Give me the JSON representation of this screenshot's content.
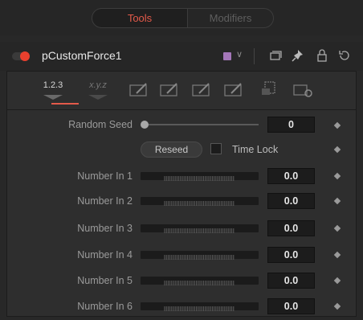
{
  "tabs": {
    "tools": "Tools",
    "modifiers": "Modifiers"
  },
  "tool": {
    "name": "pCustomForce1",
    "color": "#a477b9"
  },
  "panel_tabs": {
    "numbers": "1.2.3",
    "points": "x.y.z"
  },
  "random_seed": {
    "label": "Random Seed",
    "value": "0",
    "slider_fraction": 0
  },
  "reseed_button": "Reseed",
  "time_lock": {
    "label": "Time Lock",
    "checked": false
  },
  "numbers": [
    {
      "label": "Number In 1",
      "value": "0.0"
    },
    {
      "label": "Number In 2",
      "value": "0.0"
    },
    {
      "label": "Number In 3",
      "value": "0.0"
    },
    {
      "label": "Number In 4",
      "value": "0.0"
    },
    {
      "label": "Number In 5",
      "value": "0.0"
    },
    {
      "label": "Number In 6",
      "value": "0.0"
    }
  ],
  "accent_color": "#e35a4a",
  "icons": [
    "power-toggle-icon",
    "color-swatch-icon",
    "dropdown-chevron-icon",
    "collapse-panel-icon",
    "pin-icon",
    "lock-icon",
    "reset-icon",
    "edit-expression-icon",
    "image-tab-icon",
    "settings-tab-icon",
    "keyframe-diamond-icon"
  ]
}
